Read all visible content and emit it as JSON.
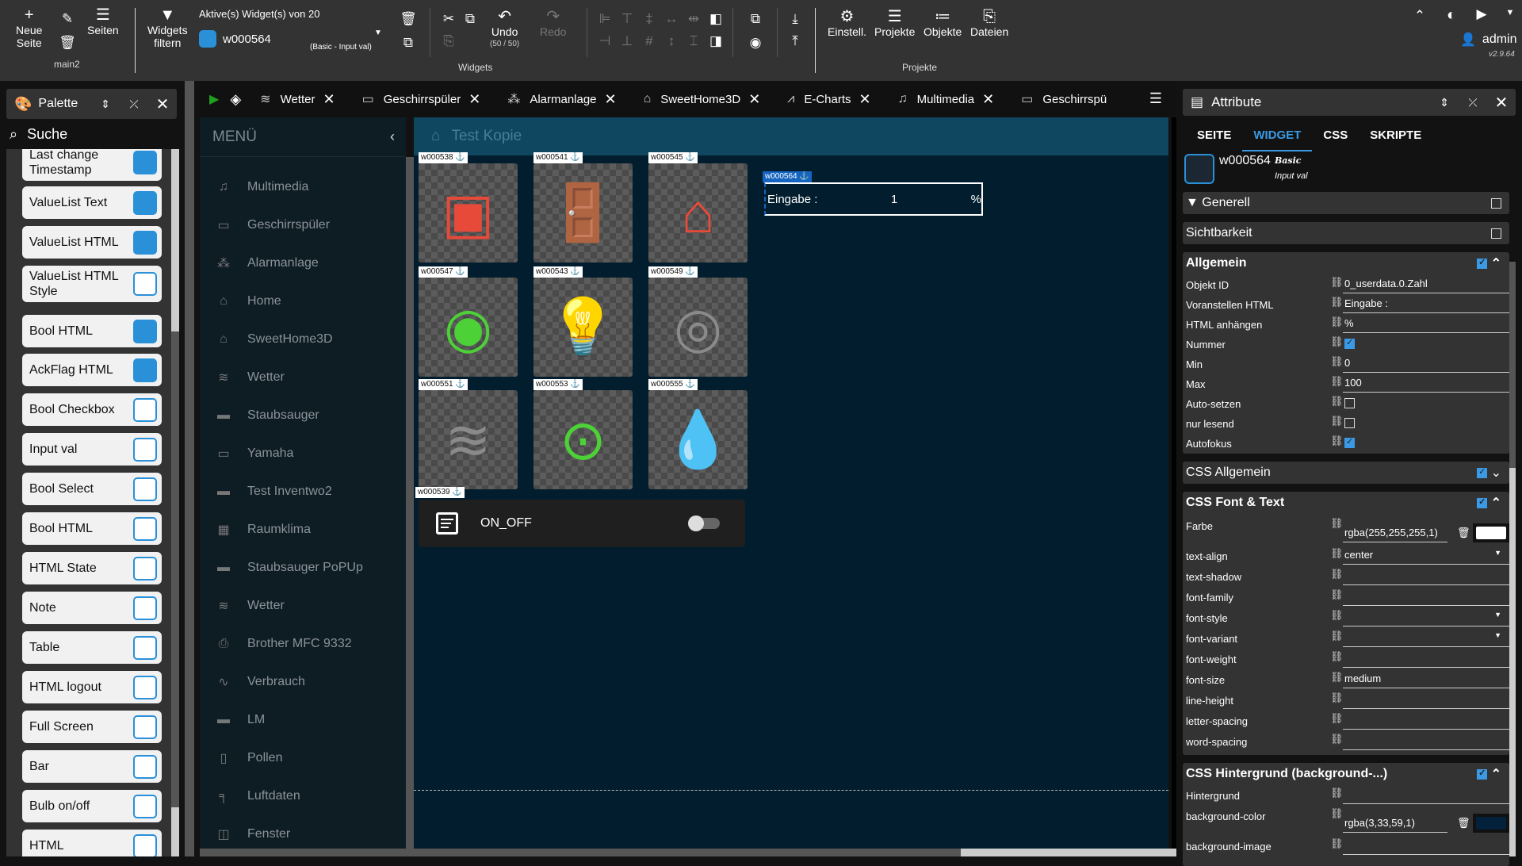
{
  "toolbar": {
    "new_page": "Neue\nSeite",
    "pages": "Seiten",
    "page_name": "main2",
    "filter_widgets": "Widgets\nfiltern",
    "active_widgets_label": "Aktive(s) Widget(s) von 20",
    "selected_widget": "w000564",
    "selected_widget_type": "(Basic - Input val)",
    "undo": "Undo",
    "undo_count": "(50 / 50)",
    "redo": "Redo",
    "widgets_group": "Widgets",
    "settings": "Einstell.",
    "projects": "Projekte",
    "objects": "Objekte",
    "files": "Dateien",
    "projects_group": "Projekte",
    "user": "admin",
    "version": "v2.9.64"
  },
  "palette": {
    "title": "Palette",
    "search_placeholder": "Suche",
    "items": [
      {
        "label": "Last change Timestamp",
        "icon": "timestamp"
      },
      {
        "label": "ValueList Text",
        "icon": "valuelist-text"
      },
      {
        "label": "ValueList HTML",
        "icon": "valuelist-html"
      },
      {
        "label": "ValueList HTML Style",
        "icon": "valuelist-html-style"
      },
      {
        "label": "Bool HTML",
        "icon": "bool-html"
      },
      {
        "label": "AckFlag HTML",
        "icon": "ackflag-html"
      },
      {
        "label": "Bool Checkbox",
        "icon": "bool-checkbox"
      },
      {
        "label": "Input val",
        "icon": "input-val"
      },
      {
        "label": "Bool Select",
        "icon": "bool-select"
      },
      {
        "label": "Bool HTML",
        "icon": "bool-html-check"
      },
      {
        "label": "HTML State",
        "icon": "html-state"
      },
      {
        "label": "Note",
        "icon": "note"
      },
      {
        "label": "Table",
        "icon": "table"
      },
      {
        "label": "HTML logout",
        "icon": "logout"
      },
      {
        "label": "Full Screen",
        "icon": "fullscreen"
      },
      {
        "label": "Bar",
        "icon": "bar"
      },
      {
        "label": "Bulb on/off",
        "icon": "bulb"
      },
      {
        "label": "HTML",
        "icon": "html"
      }
    ]
  },
  "tabs": [
    {
      "label": "Wetter",
      "icon": "weather-icon"
    },
    {
      "label": "Geschirrspüler",
      "icon": "dishwasher-icon"
    },
    {
      "label": "Alarmanlage",
      "icon": "alarm-icon"
    },
    {
      "label": "SweetHome3D",
      "icon": "home-outline-icon"
    },
    {
      "label": "E-Charts",
      "icon": "chart-icon"
    },
    {
      "label": "Multimedia",
      "icon": "music-icon"
    },
    {
      "label": "Geschirrspü",
      "icon": "dishwasher-icon"
    }
  ],
  "menu": {
    "title": "MENÜ",
    "items": [
      {
        "label": "Multimedia",
        "icon": "♫"
      },
      {
        "label": "Geschirrspüler",
        "icon": "▭"
      },
      {
        "label": "Alarmanlage",
        "icon": "⁂"
      },
      {
        "label": "Home",
        "icon": "⌂"
      },
      {
        "label": "SweetHome3D",
        "icon": "⌂"
      },
      {
        "label": "Wetter",
        "icon": "≋"
      },
      {
        "label": "Staubsauger",
        "icon": "▬"
      },
      {
        "label": "Yamaha",
        "icon": "▭"
      },
      {
        "label": "Test Inventwo2",
        "icon": "▬"
      },
      {
        "label": "Raumklima",
        "icon": "▦"
      },
      {
        "label": "Staubsauger PoPUp",
        "icon": "▬"
      },
      {
        "label": "Wetter",
        "icon": "≋"
      },
      {
        "label": "Brother MFC 9332",
        "icon": "⎙"
      },
      {
        "label": "Verbrauch",
        "icon": "∿"
      },
      {
        "label": "LM",
        "icon": "▬"
      },
      {
        "label": "Pollen",
        "icon": "▯"
      },
      {
        "label": "Luftdaten",
        "icon": "╕"
      },
      {
        "label": "Fenster",
        "icon": "◫"
      }
    ]
  },
  "canvas": {
    "view_title": "Test Kopie",
    "widgets": [
      {
        "id": "w000538",
        "icon": "window-open",
        "color": "#e84a3a"
      },
      {
        "id": "w000541",
        "icon": "door-open",
        "color": "#e84a3a"
      },
      {
        "id": "w000545",
        "icon": "house-alarm",
        "color": "#e84a3a"
      },
      {
        "id": "w000547",
        "icon": "camera",
        "color": "#4cd137"
      },
      {
        "id": "w000543",
        "icon": "bulb",
        "color": "#e5e03a"
      },
      {
        "id": "w000549",
        "icon": "washing-machine",
        "color": "#8a8a8a"
      },
      {
        "id": "w000551",
        "icon": "air-conditioner",
        "color": "#8a8a8a"
      },
      {
        "id": "w000553",
        "icon": "socket",
        "color": "#4cd137"
      },
      {
        "id": "w000555",
        "icon": "humidity",
        "color": "#8a8a8a"
      }
    ],
    "input_widget": {
      "id": "w000564",
      "prepend": "Eingabe :",
      "value": "1",
      "append": "%"
    },
    "switch_widget": {
      "id": "w000539",
      "label": "ON_OFF",
      "on": false
    }
  },
  "attributes": {
    "title": "Attribute",
    "tabs": [
      "SEITE",
      "WIDGET",
      "CSS",
      "SKRIPTE"
    ],
    "active_tab": "WIDGET",
    "widget_id": "w000564",
    "widget_set": "Basic",
    "widget_type": "Input val",
    "sections": {
      "generell": "Generell",
      "sichtbarkeit": "Sichtbarkeit",
      "allgemein": "Allgemein",
      "css_allgemein": "CSS Allgemein",
      "css_font": "CSS Font & Text",
      "css_bg": "CSS Hintergrund (background-...)"
    },
    "allgemein": [
      {
        "label": "Objekt ID",
        "value": "0_userdata.0.Zahl"
      },
      {
        "label": "Voranstellen HTML",
        "value": "Eingabe :"
      },
      {
        "label": "HTML anhängen",
        "value": "%"
      },
      {
        "label": "Nummer",
        "checked": true
      },
      {
        "label": "Min",
        "value": "0"
      },
      {
        "label": "Max",
        "value": "100"
      },
      {
        "label": "Auto-setzen",
        "checked": false
      },
      {
        "label": "nur lesend",
        "checked": false
      },
      {
        "label": "Autofokus",
        "checked": true
      }
    ],
    "font": [
      {
        "label": "Farbe",
        "value": "rgba(255,255,255,1)",
        "swatch": "#ffffff"
      },
      {
        "label": "text-align",
        "value": "center",
        "dropdown": true
      },
      {
        "label": "text-shadow",
        "value": ""
      },
      {
        "label": "font-family",
        "value": ""
      },
      {
        "label": "font-style",
        "value": "",
        "dropdown": true
      },
      {
        "label": "font-variant",
        "value": "",
        "dropdown": true
      },
      {
        "label": "font-weight",
        "value": ""
      },
      {
        "label": "font-size",
        "value": "medium"
      },
      {
        "label": "line-height",
        "value": ""
      },
      {
        "label": "letter-spacing",
        "value": ""
      },
      {
        "label": "word-spacing",
        "value": ""
      }
    ],
    "background": [
      {
        "label": "Hintergrund",
        "value": ""
      },
      {
        "label": "background-color",
        "value": "rgba(3,33,59,1)",
        "swatch": "#03213b"
      },
      {
        "label": "background-image",
        "value": ""
      }
    ]
  }
}
